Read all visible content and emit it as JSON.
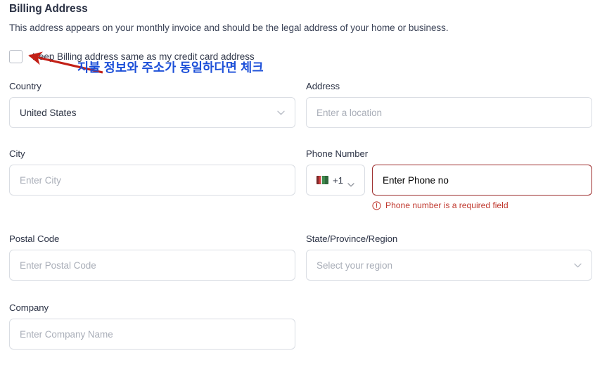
{
  "section": {
    "title": "Billing Address",
    "description": "This address appears on your monthly invoice and should be the legal address of your home or business."
  },
  "checkbox": {
    "label": "Keep Billing address same as my credit card address",
    "checked": false
  },
  "annotation": {
    "text": "지불 정보와 주소가 동일하다면 체크",
    "text_color": "#1c4fd8",
    "arrow_color": "#c21f16"
  },
  "fields": {
    "country": {
      "label": "Country",
      "value": "United States",
      "icon": "chevron-down-icon"
    },
    "address": {
      "label": "Address",
      "value": "",
      "placeholder": "Enter a location"
    },
    "city": {
      "label": "City",
      "value": "",
      "placeholder": "Enter City"
    },
    "phone": {
      "label": "Phone Number",
      "country_code": "+1",
      "flag": "us-flag-icon",
      "value": "",
      "placeholder": "Enter Phone no",
      "error": "Phone number is a required field",
      "error_icon": "alert-circle-icon",
      "error_color": "#c0392f",
      "border_color": "#9e2f2f"
    },
    "postal_code": {
      "label": "Postal Code",
      "value": "",
      "placeholder": "Enter Postal Code"
    },
    "region": {
      "label": "State/Province/Region",
      "value": "",
      "placeholder": "Select your region",
      "icon": "chevron-down-icon"
    },
    "company": {
      "label": "Company",
      "value": "",
      "placeholder": "Enter Company Name"
    }
  },
  "colors": {
    "title": "#2b3245",
    "label": "#2b3245",
    "placeholder": "#a9aeb8",
    "border": "#d9dde3"
  }
}
